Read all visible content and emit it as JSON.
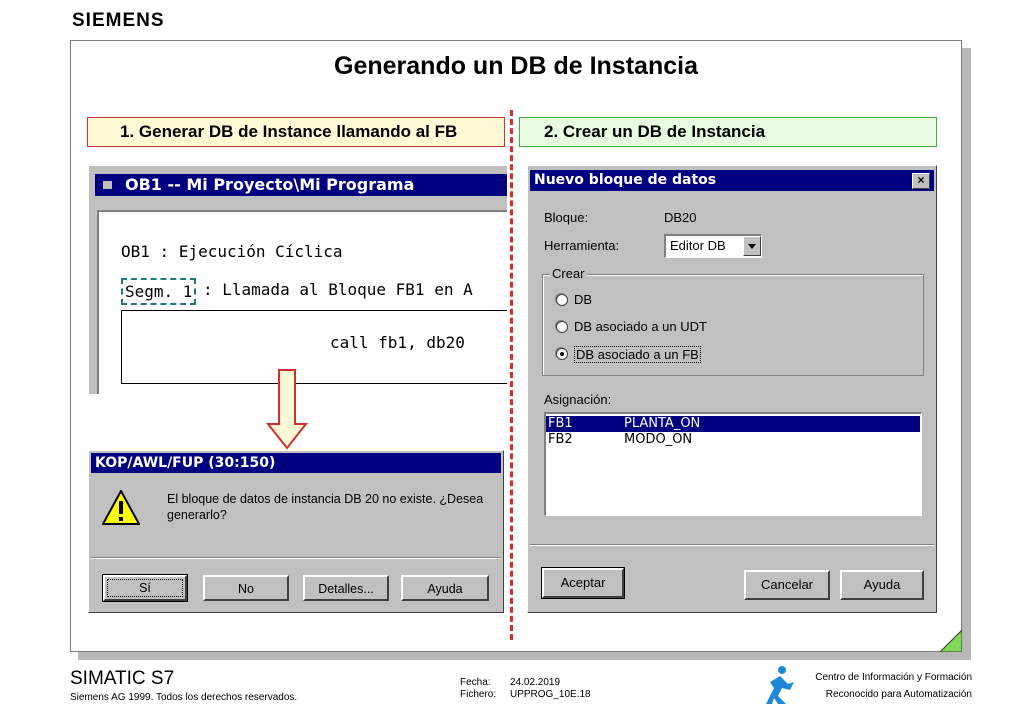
{
  "header": {
    "brand": "SIEMENS",
    "title": "Generando un DB de Instancia"
  },
  "steps": {
    "step1": "1. Generar  DB de Instance llamando al FB",
    "step2": "2. Crear un DB de Instancia"
  },
  "ob1_window": {
    "title": "OB1 -- Mi Proyecto\\Mi Programa",
    "heading": "OB1 : Ejecución Cíclica",
    "segment": "Segm. 1",
    "segment_text": ": Llamada al Bloque FB1 en A",
    "code": "call fb1, db20"
  },
  "message_box": {
    "title": "KOP/AWL/FUP  (30:150)",
    "text": "El bloque de datos de instancia DB 20 no existe. ¿Desea generarlo?",
    "buttons": {
      "si": "Sí",
      "no": "No",
      "detalles": "Detalles...",
      "ayuda": "Ayuda"
    }
  },
  "new_block_dialog": {
    "title": "Nuevo bloque de datos",
    "close": "×",
    "bloque_label": "Bloque:",
    "bloque_value": "DB20",
    "herramienta_label": "Herramienta:",
    "herramienta_value": "Editor DB",
    "crear_label": "Crear",
    "options": [
      "DB",
      "DB asociado a un UDT",
      "DB asociado a un FB"
    ],
    "selected_option": "DB asociado a un FB",
    "asignacion_label": "Asignación:",
    "assignments": [
      {
        "block": "FB1",
        "name": "PLANTA_ON",
        "selected": true
      },
      {
        "block": "FB2",
        "name": "MODO_ON",
        "selected": false
      }
    ],
    "buttons": {
      "aceptar": "Aceptar",
      "cancelar": "Cancelar",
      "ayuda": "Ayuda"
    }
  },
  "footer": {
    "product": "SIMATIC S7",
    "copyright": "Siemens AG 1999. Todos los derechos reservados.",
    "fecha_label": "Fecha:",
    "fecha_value": "24.02.2019",
    "fichero_label": "Fichero:",
    "fichero_value": "UPPROG_10E.18",
    "centro": "Centro de Información y Formación",
    "reconocido": "Reconocido para Automatización"
  },
  "colors": {
    "titlebar": "#000080",
    "step1_bg": "#fff9d6",
    "step2_bg": "#e6fbe0",
    "divider": "#d03030",
    "accent_green": "#7ed957",
    "logo_blue": "#1e88d8"
  }
}
